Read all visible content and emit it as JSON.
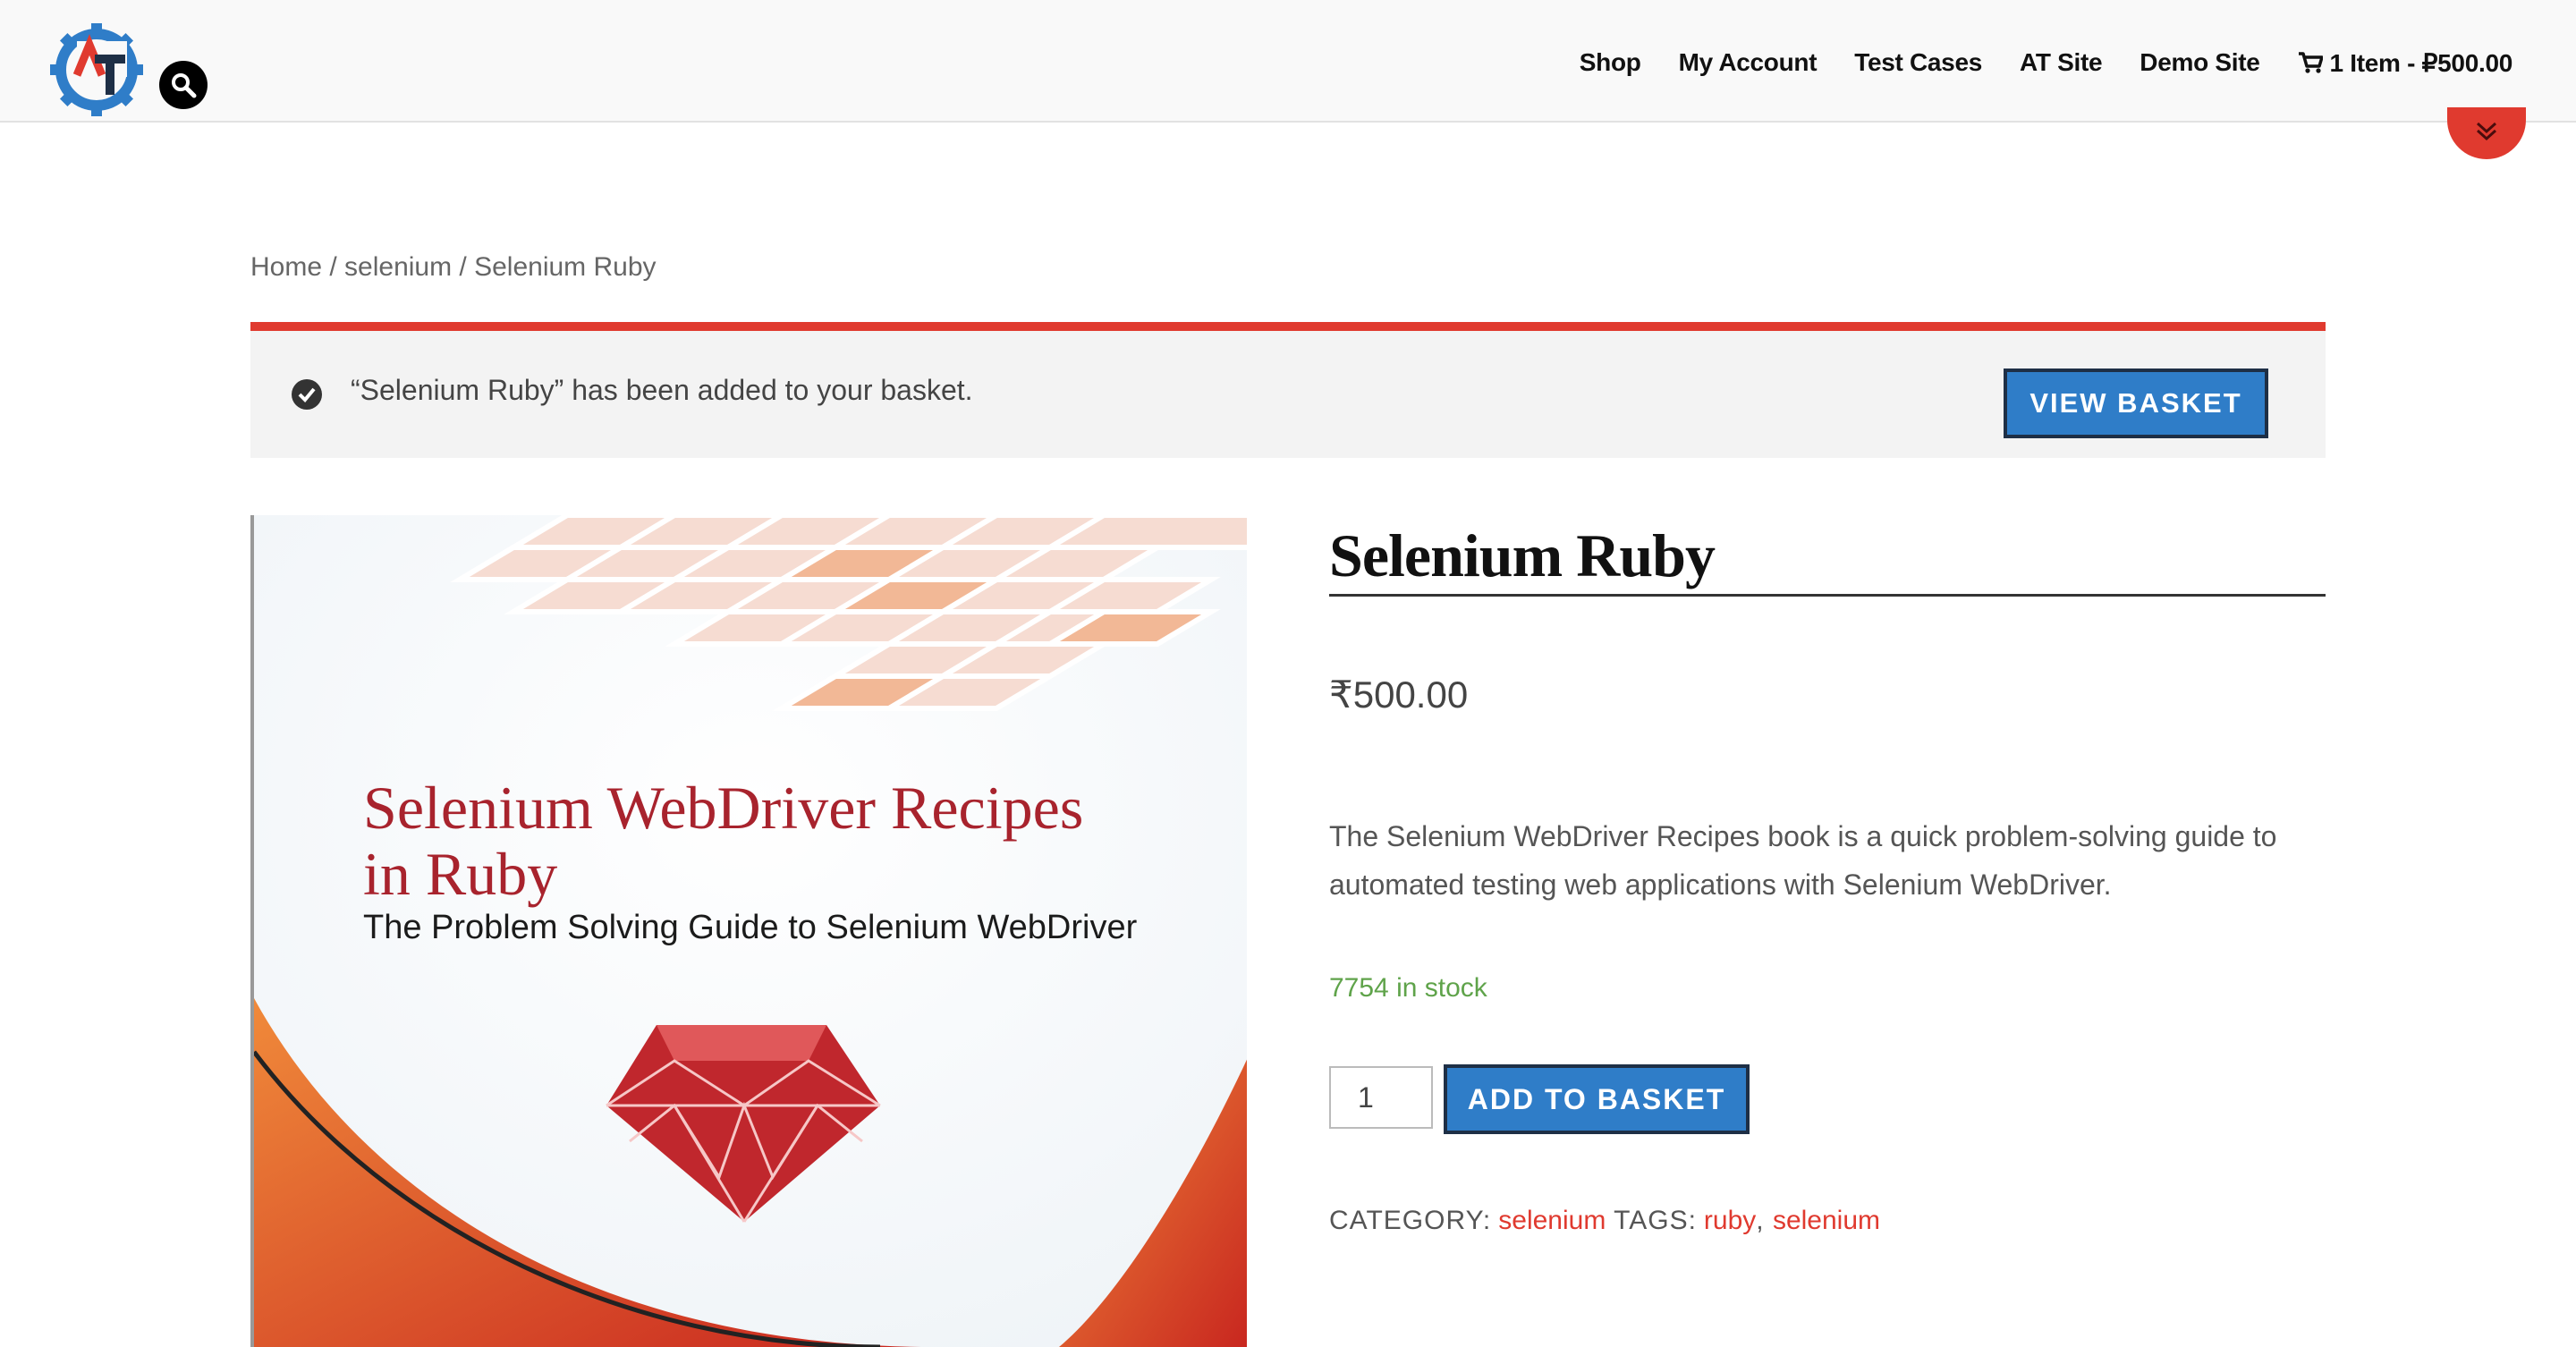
{
  "header": {
    "nav": [
      "Shop",
      "My Account",
      "Test Cases",
      "AT Site",
      "Demo Site"
    ],
    "cart_label": "1 Item - ₽500.00"
  },
  "breadcrumb": "Home / selenium / Selenium Ruby",
  "notice": {
    "message": "“Selenium Ruby” has been added to your basket.",
    "button": "VIEW BASKET"
  },
  "product": {
    "title": "Selenium Ruby",
    "price": "₹500.00",
    "description": "The Selenium WebDriver Recipes book is a quick problem-solving guide to automated testing web applications with Selenium WebDriver.",
    "stock": "7754 in stock",
    "quantity": "1",
    "add_button": "ADD TO BASKET",
    "category_label": "CATEGORY:",
    "category": "selenium",
    "tags_label": "TAGS:",
    "tags": [
      "ruby",
      "selenium"
    ],
    "cover": {
      "title_line1": "Selenium WebDriver Recipes",
      "title_line2": "in Ruby",
      "subtitle": "The Problem Solving Guide to Selenium WebDriver"
    }
  },
  "icons": {
    "logo": "gear-logo-icon",
    "search": "search-icon",
    "cart": "cart-icon",
    "scroll": "chevron-down-icon",
    "check": "check-circle-icon"
  },
  "colors": {
    "accent_red": "#e03a2f",
    "button_blue": "#2f7dc8",
    "stock_green": "#5fa34a"
  }
}
